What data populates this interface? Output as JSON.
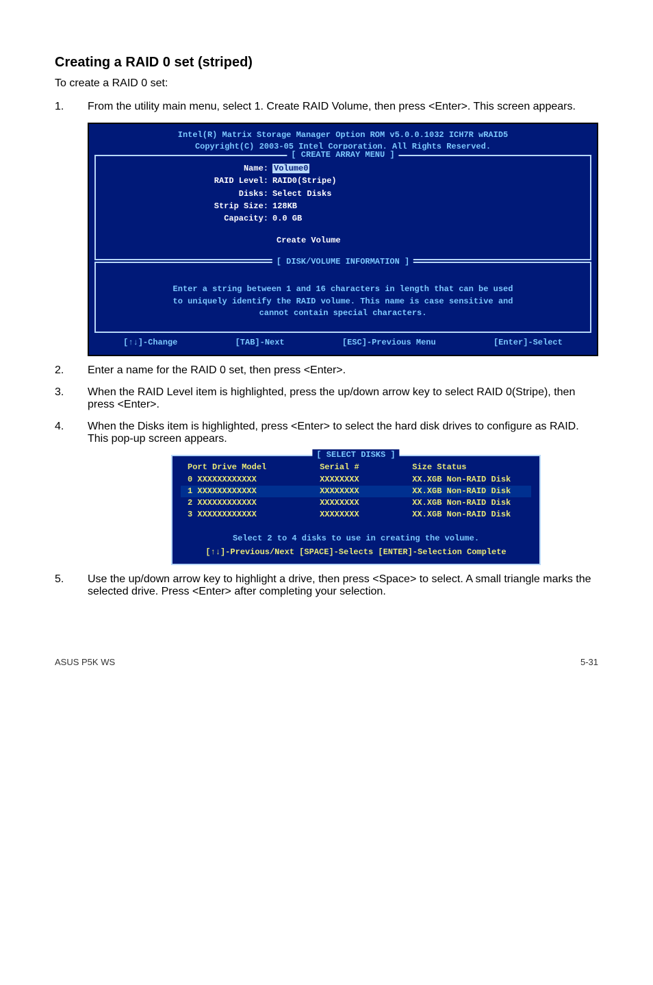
{
  "heading": "Creating a RAID 0 set (striped)",
  "intro": "To create a RAID 0 set:",
  "steps": {
    "s1": {
      "num": "1.",
      "text": "From the utility main menu, select 1. Create RAID Volume, then press <Enter>. This screen appears."
    },
    "s2": {
      "num": "2.",
      "text": "Enter a name for the RAID 0 set, then press <Enter>."
    },
    "s3": {
      "num": "3.",
      "text": "When the RAID Level item is highlighted, press the up/down arrow key to select RAID 0(Stripe), then press <Enter>."
    },
    "s4": {
      "num": "4.",
      "text": "When the Disks item is highlighted, press <Enter> to select the hard disk drives to configure as RAID. This pop-up screen appears."
    },
    "s5": {
      "num": "5.",
      "text": "Use the up/down arrow key to highlight a drive, then press <Space>  to select. A small triangle marks the selected drive. Press <Enter> after completing your selection."
    }
  },
  "bios": {
    "title1": "Intel(R) Matrix Storage Manager Option ROM v5.0.0.1032 ICH7R wRAID5",
    "title2": "Copyright(C) 2003-05 Intel Corporation. All Rights Reserved.",
    "createMenu": "[ CREATE ARRAY MENU ]",
    "fields": {
      "name": {
        "label": "Name:",
        "value": "Volume0"
      },
      "raidLevel": {
        "label": "RAID Level:",
        "value": "RAID0(Stripe)"
      },
      "disks": {
        "label": "Disks:",
        "value": "Select Disks"
      },
      "stripSize": {
        "label": "Strip Size:",
        "value": "128KB"
      },
      "capacity": {
        "label": "Capacity:",
        "value": "0.0   GB"
      }
    },
    "createVolume": "Create Volume",
    "diskInfoLabel": "[ DISK/VOLUME INFORMATION ]",
    "diskInfoText1": "Enter a string between 1 and 16 characters in length that can be used",
    "diskInfoText2": "to uniquely identify the RAID volume. This name is case sensitive and",
    "diskInfoText3": "cannot contain special characters.",
    "bottom": {
      "change": "[↑↓]-Change",
      "tab": "[TAB]-Next",
      "esc": "[ESC]-Previous Menu",
      "enter": "[Enter]-Select"
    }
  },
  "disks": {
    "title": "[ SELECT DISKS ]",
    "header": {
      "c1": "Port Drive Model",
      "c2": "Serial #",
      "c3": "Size Status"
    },
    "rows": [
      {
        "c1": "0 XXXXXXXXXXXX",
        "c2": "XXXXXXXX",
        "c3": "XX.XGB Non-RAID Disk"
      },
      {
        "c1": "1 XXXXXXXXXXXX",
        "c2": "XXXXXXXX",
        "c3": "XX.XGB Non-RAID Disk"
      },
      {
        "c1": "2 XXXXXXXXXXXX",
        "c2": "XXXXXXXX",
        "c3": "XX.XGB Non-RAID Disk"
      },
      {
        "c1": "3 XXXXXXXXXXXX",
        "c2": "XXXXXXXX",
        "c3": "XX.XGB Non-RAID Disk"
      }
    ],
    "instr": "Select 2 to 4 disks to use in creating the volume.",
    "nav": "[↑↓]-Previous/Next  [SPACE]-Selects  [ENTER]-Selection Complete"
  },
  "footer": {
    "left": "ASUS P5K WS",
    "right": "5-31"
  }
}
